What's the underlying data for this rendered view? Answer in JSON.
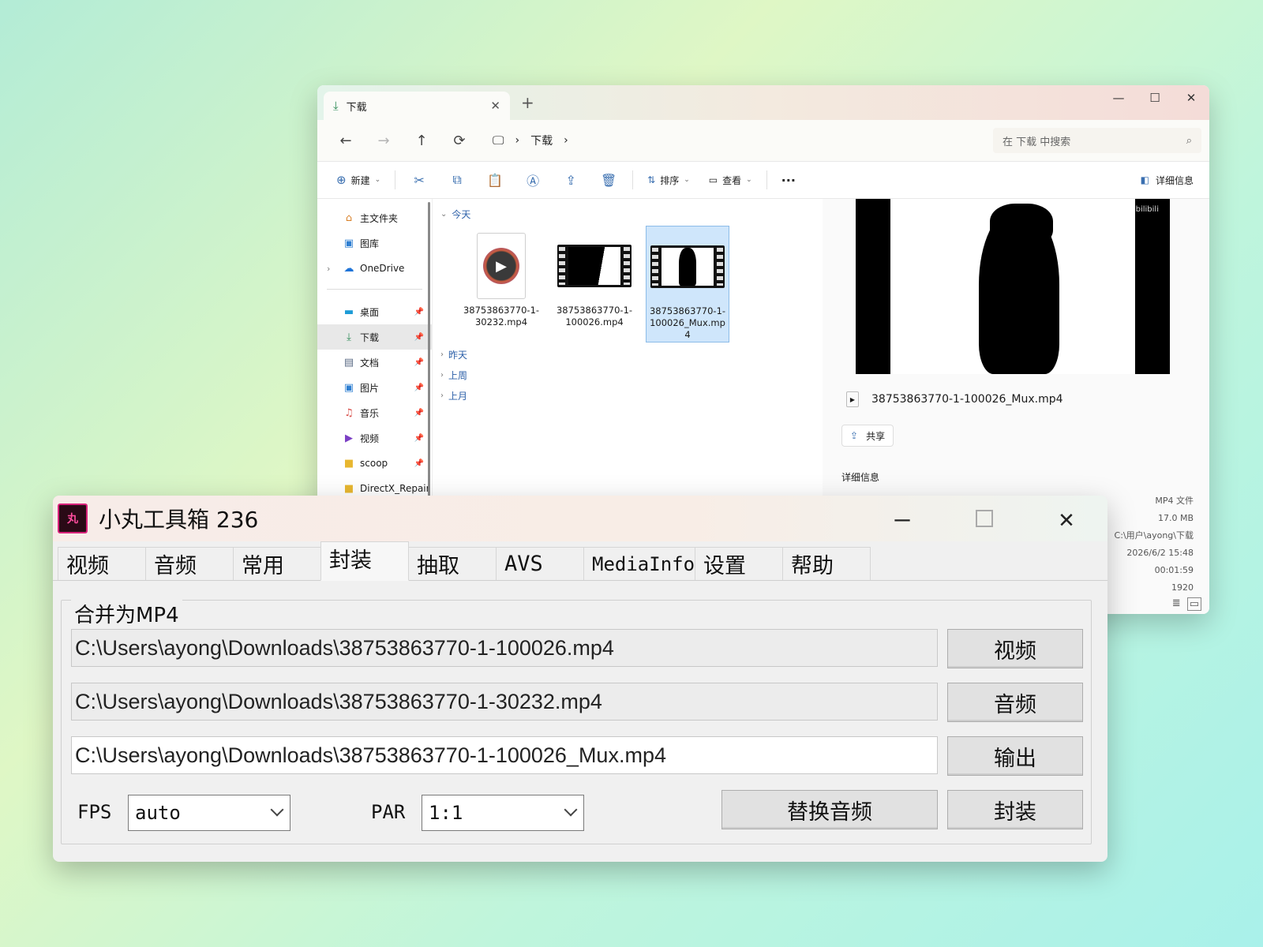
{
  "explorer": {
    "tab_title": "下载",
    "tab_close": "✕",
    "new_tab": "+",
    "window_controls": {
      "minimize": "—",
      "maximize": "☐",
      "close": "✕"
    },
    "nav": {
      "back": "←",
      "forward": "→",
      "up": "↑",
      "refresh": "⟳"
    },
    "breadcrumb": {
      "sep1": "›",
      "folder": "下载",
      "sep2": "›"
    },
    "search_placeholder": "在 下载 中搜索",
    "commands": {
      "new": "新建",
      "sort": "排序",
      "view": "查看",
      "more": "···",
      "details": "详细信息"
    },
    "sidebar": {
      "home": "主文件夹",
      "gallery": "图库",
      "onedrive": "OneDrive",
      "pinned": [
        {
          "label": "桌面"
        },
        {
          "label": "下载"
        },
        {
          "label": "文档"
        },
        {
          "label": "图片"
        },
        {
          "label": "音乐"
        },
        {
          "label": "视频"
        },
        {
          "label": "scoop"
        },
        {
          "label": "DirectX_Repair"
        }
      ]
    },
    "groups": {
      "today": "今天",
      "yesterday": "昨天",
      "last_week": "上周",
      "last_month": "上月"
    },
    "files": [
      {
        "name": "38753863770-1-30232.mp4"
      },
      {
        "name": "38753863770-1-100026.mp4"
      },
      {
        "name": "38753863770-1-100026_Mux.mp4"
      }
    ],
    "preview": {
      "watermark": "bilibili",
      "file_name": "38753863770-1-100026_Mux.mp4",
      "share": "共享",
      "details_title": "详细信息",
      "values": [
        "MP4 文件",
        "17.0 MB",
        "C:\\用户\\ayong\\下载",
        "2026/6/2 15:48",
        "00:01:59",
        "1920"
      ]
    }
  },
  "toolbox": {
    "logo_text": "丸",
    "title": "小丸工具箱 236",
    "window_controls": {
      "minimize": "—",
      "close": "✕"
    },
    "tabs": [
      "视频",
      "音频",
      "常用",
      "封装",
      "抽取",
      "AVS",
      "MediaInfo",
      "设置",
      "帮助"
    ],
    "active_tab": "封装",
    "group_label": "合并为MP4",
    "video_path": "C:\\Users\\ayong\\Downloads\\38753863770-1-100026.mp4",
    "audio_path": "C:\\Users\\ayong\\Downloads\\38753863770-1-30232.mp4",
    "output_path": "C:\\Users\\ayong\\Downloads\\38753863770-1-100026_Mux.mp4",
    "buttons": {
      "video": "视频",
      "audio": "音频",
      "output": "输出",
      "replace_audio": "替换音频",
      "mux": "封装"
    },
    "fps_label": "FPS",
    "fps_value": "auto",
    "par_label": "PAR",
    "par_value": "1:1"
  }
}
